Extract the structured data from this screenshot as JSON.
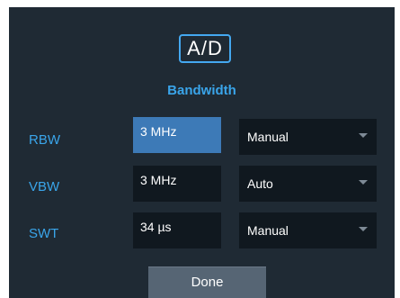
{
  "dialog": {
    "icon_label": "A/D",
    "title": "Bandwidth",
    "rows": [
      {
        "label": "RBW",
        "value": "3 MHz",
        "mode": "Manual"
      },
      {
        "label": "VBW",
        "value": "3 MHz",
        "mode": "Auto"
      },
      {
        "label": "SWT",
        "value": "34 µs",
        "mode": "Manual"
      }
    ],
    "done_label": "Done"
  },
  "colors": {
    "background": "#1f2a34",
    "accent": "#3aa5ea",
    "field": "#10181f",
    "selected_field": "#3d7ab7",
    "button": "#566574"
  }
}
